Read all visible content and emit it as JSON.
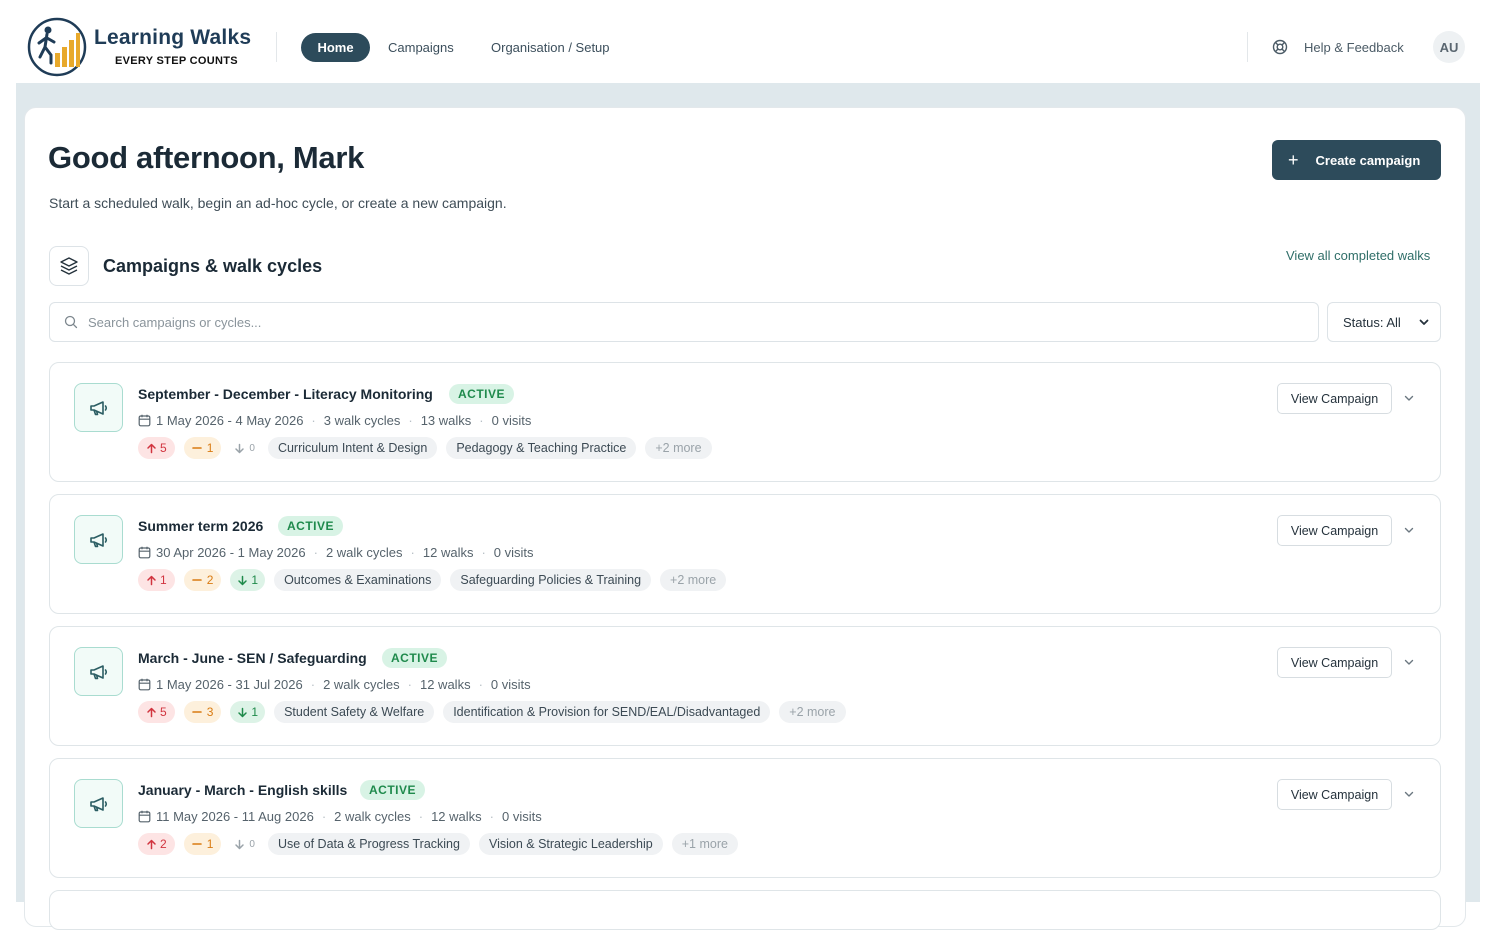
{
  "brand": {
    "title": "Learning Walks",
    "tagline": "EVERY STEP COUNTS"
  },
  "nav": {
    "home": "Home",
    "campaigns": "Campaigns",
    "organisation": "Organisation / Setup"
  },
  "header": {
    "help_label": "Help & Feedback",
    "avatar_initials": "AU"
  },
  "main": {
    "greeting": "Good afternoon, Mark",
    "subtitle": "Start a scheduled walk, begin an ad-hoc cycle, or create a new campaign.",
    "create_label": "Create campaign",
    "section_title": "Campaigns & walk cycles",
    "view_all_label": "View all completed walks",
    "search_placeholder": "Search campaigns or cycles...",
    "status_filter": "Status: All"
  },
  "campaigns": [
    {
      "name": "September - December - Literacy Monitoring",
      "status": "ACTIVE",
      "dates": "1 May 2026 - 4 May 2026",
      "cycles": "3 walk cycles",
      "walks": "13 walks",
      "visits": "0 visits",
      "up": "5",
      "mid": "1",
      "down": "0",
      "tags": [
        "Curriculum Intent & Design",
        "Pedagogy & Teaching Practice"
      ],
      "more": "+2 more",
      "view_label": "View Campaign"
    },
    {
      "name": "Summer term 2026",
      "status": "ACTIVE",
      "dates": "30 Apr 2026 - 1 May 2026",
      "cycles": "2 walk cycles",
      "walks": "12 walks",
      "visits": "0 visits",
      "up": "1",
      "mid": "2",
      "down": "1",
      "tags": [
        "Outcomes & Examinations",
        "Safeguarding Policies & Training"
      ],
      "more": "+2 more",
      "view_label": "View Campaign"
    },
    {
      "name": "March - June - SEN / Safeguarding",
      "status": "ACTIVE",
      "dates": "1 May 2026 - 31 Jul 2026",
      "cycles": "2 walk cycles",
      "walks": "12 walks",
      "visits": "0 visits",
      "up": "5",
      "mid": "3",
      "down": "1",
      "tags": [
        "Student Safety & Welfare",
        "Identification & Provision for SEND/EAL/Disadvantaged"
      ],
      "more": "+2 more",
      "view_label": "View Campaign"
    },
    {
      "name": "January - March - English skills",
      "status": "ACTIVE",
      "dates": "11 May 2026 - 11 Aug 2026",
      "cycles": "2 walk cycles",
      "walks": "12 walks",
      "visits": "0 visits",
      "up": "2",
      "mid": "1",
      "down": "0",
      "tags": [
        "Use of Data & Progress Tracking",
        "Vision & Strategic Leadership"
      ],
      "more": "+1 more",
      "view_label": "View Campaign"
    }
  ],
  "colors": {
    "primary": "#2d4b5b",
    "accent": "#2f6e68",
    "active_badge": "#1f8a4c"
  }
}
